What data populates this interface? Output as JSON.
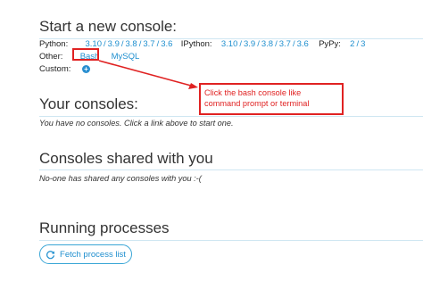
{
  "new_console": {
    "title": "Start a new console:",
    "python_label": "Python:",
    "python_versions": [
      "3.10",
      "3.9",
      "3.8",
      "3.7",
      "3.6"
    ],
    "ipython_label": "IPython:",
    "ipython_versions": [
      "3.10",
      "3.9",
      "3.8",
      "3.7",
      "3.6"
    ],
    "pypy_label": "PyPy:",
    "pypy_versions": [
      "2",
      "3"
    ],
    "other_label": "Other:",
    "other_links": [
      "Bash",
      "MySQL"
    ],
    "custom_label": "Custom:",
    "custom_icon": "plus-circle-icon",
    "separator": "/"
  },
  "callout": {
    "text": "Click the bash console like command prompt or terminal",
    "color": "#e02222"
  },
  "your_consoles": {
    "title": "Your consoles:",
    "empty_text": "You have no consoles. Click a link above to start one."
  },
  "shared_consoles": {
    "title": "Consoles shared with you",
    "empty_text": "No-one has shared any consoles with you :-("
  },
  "processes": {
    "title": "Running processes",
    "fetch_label": "Fetch process list",
    "fetch_icon": "refresh-icon"
  },
  "colors": {
    "link": "#1f8fcf",
    "rule": "#cfe6f2",
    "annotation": "#e02222"
  }
}
